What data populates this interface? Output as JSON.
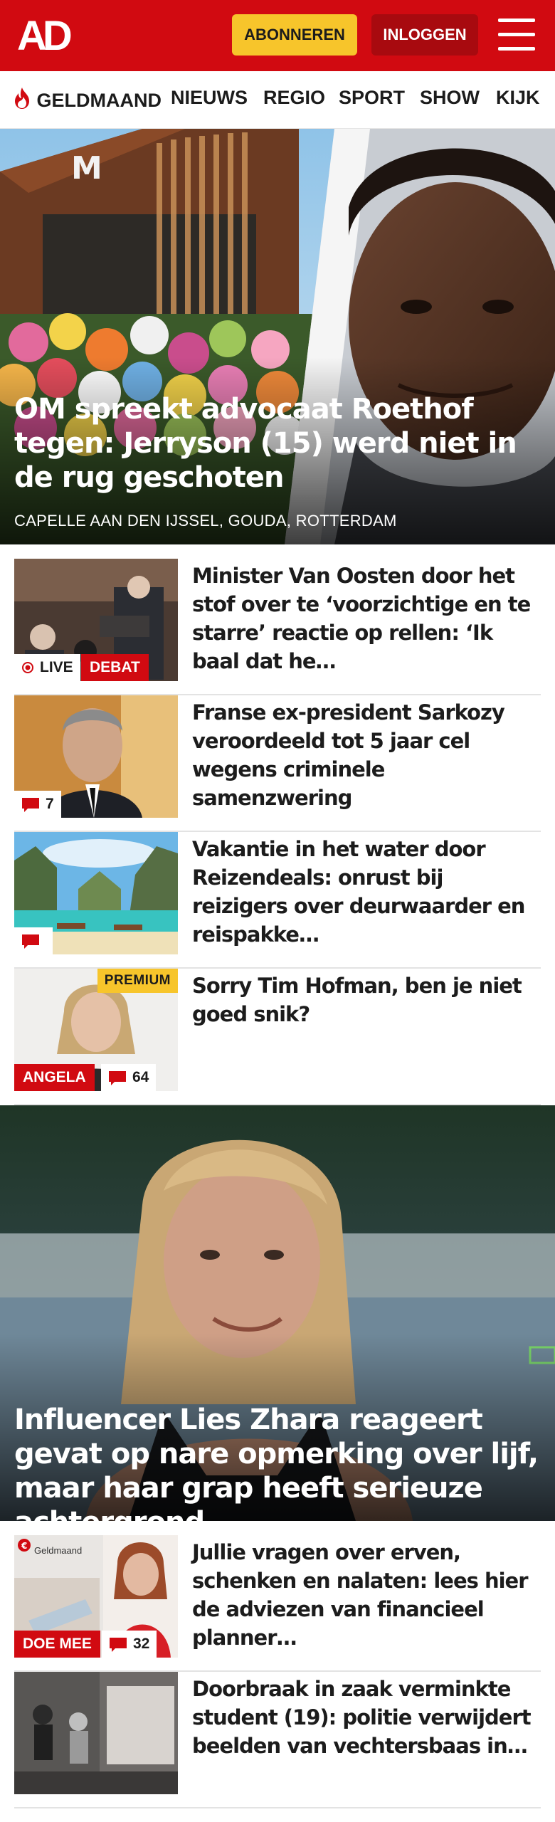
{
  "header": {
    "logo": "AD",
    "subscribe_label": "ABONNEREN",
    "login_label": "INLOGGEN"
  },
  "nav": {
    "items": [
      {
        "label": "GELDMAAND",
        "icon": "flame-icon"
      },
      {
        "label": "NIEUWS"
      },
      {
        "label": "REGIO"
      },
      {
        "label": "SPORT"
      },
      {
        "label": "SHOW"
      },
      {
        "label": "KIJK"
      }
    ]
  },
  "hero1": {
    "title": "OM spreekt advocaat Roethof tegen: Jerryson (15) werd niet in de rug geschoten",
    "subtitle": "CAPELLE AAN DEN IJSSEL, GOUDA, ROTTERDAM"
  },
  "articles": [
    {
      "title": "Minister Van Oosten door het stof over te ‘voorzichtige en te starre’ reactie op rellen: ‘Ik baal dat he…",
      "live_label": "LIVE",
      "tag": "DEBAT"
    },
    {
      "title": "Franse ex-president Sarkozy veroordeeld tot 5 jaar cel wegens criminele samenzwering",
      "comments": "7"
    },
    {
      "title": "Vakantie in het water door Reizendeals: onrust bij reizigers over deurwaarder en reispakke…",
      "comments": ""
    },
    {
      "title": "Sorry Tim Hofman, ben je niet goed snik?",
      "tag": "ANGELA",
      "comments": "64",
      "premium": "PREMIUM"
    }
  ],
  "hero2": {
    "title": "Influencer Lies Zhara reageert gevat op nare opmerking over lijf, maar haar grap heeft serieuze achtergrond"
  },
  "articles2": [
    {
      "title": "Jullie vragen over erven, schenken en nalaten: lees hier de adviezen van financieel planner…",
      "tag": "DOE MEE",
      "comments": "32",
      "thumb_label": "Geldmaand"
    },
    {
      "title": "Doorbraak in zaak verminkte student (19): politie verwijdert beelden van vechtersbaas in…"
    }
  ],
  "colors": {
    "brand_red": "#d10a11",
    "subscribe_yellow": "#f7c52b",
    "login_dark_red": "#a80a0f"
  }
}
